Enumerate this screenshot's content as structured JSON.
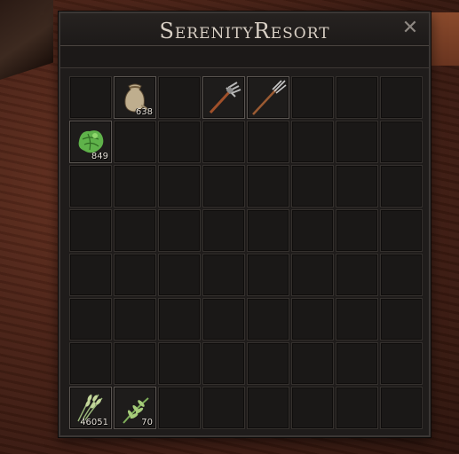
{
  "window": {
    "title": "SerenityResort",
    "close_glyph": "✕"
  },
  "grid": {
    "columns": 8,
    "rows": 8
  },
  "items": [
    {
      "slot": 1,
      "icon": "sack-icon",
      "quantity": "638"
    },
    {
      "slot": 3,
      "icon": "pitchfork-icon",
      "quantity": ""
    },
    {
      "slot": 4,
      "icon": "spear-icon",
      "quantity": ""
    },
    {
      "slot": 8,
      "icon": "green-herb-icon",
      "quantity": "849"
    },
    {
      "slot": 56,
      "icon": "wheat-bundle-icon",
      "quantity": "46051"
    },
    {
      "slot": 57,
      "icon": "grass-sprig-icon",
      "quantity": "70"
    }
  ]
}
